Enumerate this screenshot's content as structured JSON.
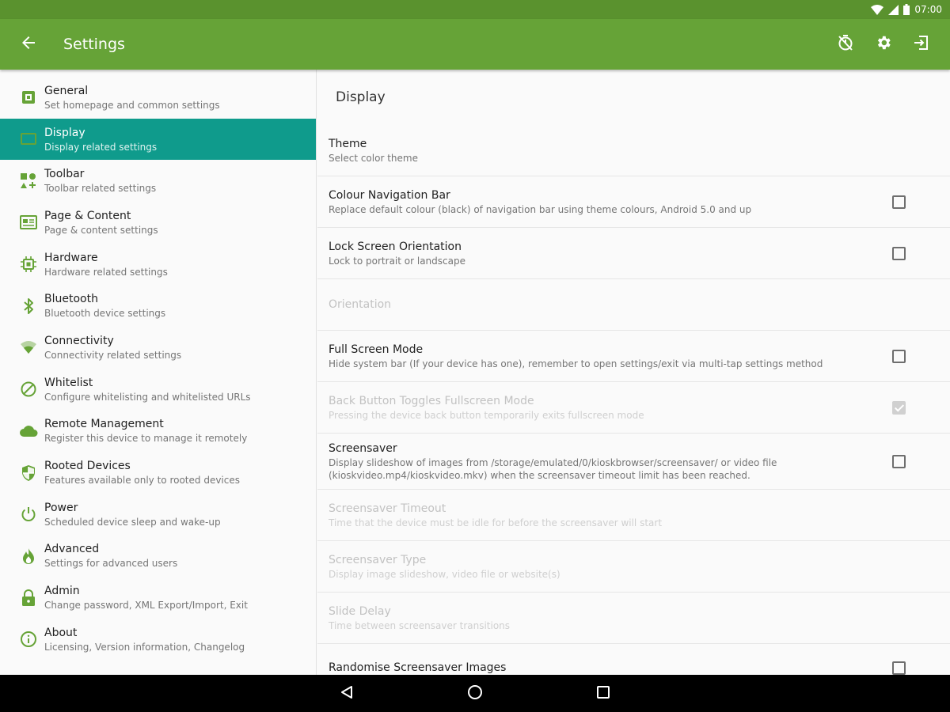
{
  "status_bar": {
    "time": "07:00",
    "icons": [
      "wifi-icon",
      "signal-icon",
      "battery-icon"
    ]
  },
  "app_bar": {
    "title": "Settings",
    "back_icon": "arrow-back-icon",
    "actions": [
      "timer-off-icon",
      "gear-icon",
      "exit-icon"
    ]
  },
  "sidebar": {
    "items": [
      {
        "icon": "general-icon",
        "title": "General",
        "subtitle": "Set homepage and common settings",
        "active": false
      },
      {
        "icon": "display-icon",
        "title": "Display",
        "subtitle": "Display related settings",
        "active": true
      },
      {
        "icon": "toolbar-icon",
        "title": "Toolbar",
        "subtitle": "Toolbar related settings",
        "active": false
      },
      {
        "icon": "page-content-icon",
        "title": "Page & Content",
        "subtitle": "Page & content settings",
        "active": false
      },
      {
        "icon": "hardware-icon",
        "title": "Hardware",
        "subtitle": "Hardware related settings",
        "active": false
      },
      {
        "icon": "bluetooth-icon",
        "title": "Bluetooth",
        "subtitle": "Bluetooth device settings",
        "active": false
      },
      {
        "icon": "connectivity-icon",
        "title": "Connectivity",
        "subtitle": "Connectivity related settings",
        "active": false
      },
      {
        "icon": "whitelist-icon",
        "title": "Whitelist",
        "subtitle": "Configure whitelisting and whitelisted URLs",
        "active": false
      },
      {
        "icon": "cloud-icon",
        "title": "Remote Management",
        "subtitle": "Register this device to manage it remotely",
        "active": false
      },
      {
        "icon": "shield-icon",
        "title": "Rooted Devices",
        "subtitle": "Features available only to rooted devices",
        "active": false
      },
      {
        "icon": "power-icon",
        "title": "Power",
        "subtitle": "Scheduled device sleep and wake-up",
        "active": false
      },
      {
        "icon": "fire-icon",
        "title": "Advanced",
        "subtitle": "Settings for advanced users",
        "active": false
      },
      {
        "icon": "lock-icon",
        "title": "Admin",
        "subtitle": "Change password, XML Export/Import, Exit",
        "active": false
      },
      {
        "icon": "info-icon",
        "title": "About",
        "subtitle": "Licensing, Version information, Changelog",
        "active": false
      }
    ]
  },
  "content": {
    "header": "Display",
    "prefs": [
      {
        "title": "Theme",
        "subtitle": "Select color theme",
        "enabled": true,
        "checkbox": "none"
      },
      {
        "title": "Colour Navigation Bar",
        "subtitle": "Replace default colour (black) of navigation bar using theme colours, Android 5.0 and up",
        "enabled": true,
        "checkbox": "unchecked"
      },
      {
        "title": "Lock Screen Orientation",
        "subtitle": "Lock to portrait or landscape",
        "enabled": true,
        "checkbox": "unchecked"
      },
      {
        "title": "Orientation",
        "subtitle": "",
        "enabled": false,
        "checkbox": "none"
      },
      {
        "title": "Full Screen Mode",
        "subtitle": "Hide system bar (If your device has one), remember to open settings/exit via multi-tap settings method",
        "enabled": true,
        "checkbox": "unchecked"
      },
      {
        "title": "Back Button Toggles Fullscreen Mode",
        "subtitle": "Pressing the device back button temporarily exits fullscreen mode",
        "enabled": false,
        "checkbox": "checked"
      },
      {
        "title": "Screensaver",
        "subtitle": "Display slideshow of images from /storage/emulated/0/kioskbrowser/screensaver/ or video file (kioskvideo.mp4/kioskvideo.mkv) when the screensaver timeout limit has been reached.",
        "enabled": true,
        "checkbox": "unchecked"
      },
      {
        "title": "Screensaver Timeout",
        "subtitle": "Time that the device must be idle for before the screensaver will start",
        "enabled": false,
        "checkbox": "none"
      },
      {
        "title": "Screensaver Type",
        "subtitle": "Display image slideshow, video file or website(s)",
        "enabled": false,
        "checkbox": "none"
      },
      {
        "title": "Slide Delay",
        "subtitle": "Time between screensaver transitions",
        "enabled": false,
        "checkbox": "none"
      },
      {
        "title": "Randomise Screensaver Images",
        "subtitle": "",
        "enabled": true,
        "checkbox": "unchecked"
      }
    ]
  },
  "nav_bar": {
    "buttons": [
      "back-triangle-icon",
      "home-circle-icon",
      "recents-square-icon"
    ]
  },
  "colors": {
    "app_bar": "#66a337",
    "status_bar": "#5a922e",
    "active_item": "#0f9b8c",
    "icon_green": "#66a337"
  }
}
